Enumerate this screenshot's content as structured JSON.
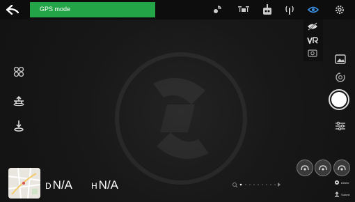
{
  "top": {
    "mode_label": "GPS mode"
  },
  "telemetry": {
    "d_label": "D",
    "d_value": "N/A",
    "h_label": "H",
    "h_value": "N/A"
  },
  "small_buttons": {
    "delete_label": "Delete",
    "submit_label": "Submit"
  },
  "icons": {
    "back": "back-arrow-icon",
    "signal": "satellite-signal-icon",
    "drone": "drone-icon",
    "controller": "remote-controller-icon",
    "wifi": "wifi-signal-icon",
    "eye": "eye-icon",
    "settings": "gear-icon",
    "eye_off": "eye-off-icon",
    "vr": "vr-icon",
    "camera_switch": "camera-switch-icon",
    "modules": "modules-icon",
    "takeoff": "takeoff-icon",
    "landing": "landing-icon",
    "gallery": "gallery-icon",
    "mode_cycle": "mode-cycle-icon",
    "adjust": "adjust-icon"
  },
  "colors": {
    "mode_bg": "#23a446",
    "accent": "#3b8fe0",
    "bg": "#151515"
  }
}
